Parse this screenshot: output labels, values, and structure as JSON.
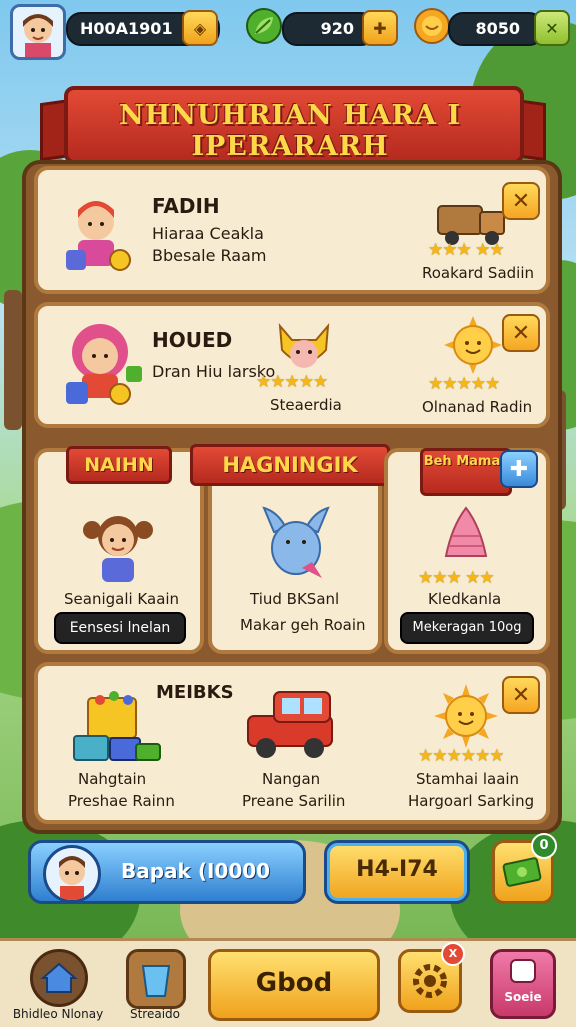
{
  "topbar": {
    "player_id": "H00A1901",
    "leaf_amount": "920",
    "coin_amount": "8050",
    "leaf_icon": "leaf-icon",
    "coin_icon": "coin-icon"
  },
  "banner": {
    "title": "NHNUHRIAN HARA  I IPERARARH"
  },
  "cards": {
    "card1": {
      "title": "FADIH",
      "line1": "Hiaraa Ceakla",
      "line2": "Bbesale Raam",
      "reward_label": "Roakard Sadiin"
    },
    "card2": {
      "title": "HOUED",
      "line1": "Dran Hiu larsko",
      "mid_label": "Steaerdia",
      "reward_label": "Olnanad Radin"
    },
    "col1": {
      "tag": "NAIHN",
      "name": "Seanigali Kaain",
      "button": "Eensesi lnelan"
    },
    "col2": {
      "tag": "HAGNINGIK",
      "line1": "Tiud BKSanl",
      "line2": "Makar geh Roain"
    },
    "col3": {
      "tag": "Beh Mamay",
      "name": "Kledkanla",
      "button": "Mekeragan 10og"
    },
    "card4": {
      "title": "MEIBKS",
      "item1_line1": "Nahgtain",
      "item1_line2": "Preshae Rainn",
      "item2_line1": "Nangan",
      "item2_line2": "Preane Sarilin",
      "item3_line1": "Stamhai laain",
      "item3_line2": "Hargoarl Sarking"
    }
  },
  "bottom": {
    "progress_label": "Bapak (I0000",
    "yellow_button": "H4-I74",
    "green_badge": "0",
    "play_button": "Gbod",
    "nav_home": "Bhidleo Nlonay",
    "nav_store": "Streaido",
    "nav_game": "Soeie",
    "notif_badge": "X"
  }
}
